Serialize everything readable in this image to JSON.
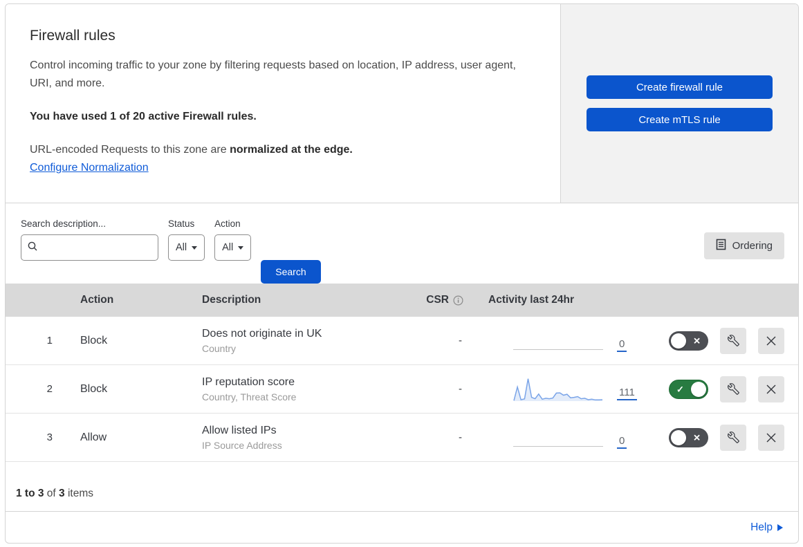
{
  "header": {
    "title": "Firewall rules",
    "description": "Control incoming traffic to your zone by filtering requests based on location, IP address, user agent, URI, and more.",
    "usage_bold": "You have used 1 of 20 active Firewall rules.",
    "normalization_prefix": "URL-encoded Requests to this zone are ",
    "normalization_bold": "normalized at the edge.",
    "normalization_link": "Configure Normalization",
    "create_firewall_button": "Create firewall rule",
    "create_mtls_button": "Create mTLS rule"
  },
  "filters": {
    "search_label": "Search description...",
    "search_value": "",
    "status_label": "Status",
    "status_value": "All",
    "action_label": "Action",
    "action_value": "All",
    "search_button": "Search",
    "ordering_button": "Ordering"
  },
  "table": {
    "headers": {
      "action": "Action",
      "description": "Description",
      "csr": "CSR",
      "activity": "Activity last 24hr"
    },
    "rows": [
      {
        "priority": "1",
        "action": "Block",
        "description": "Does not originate in UK",
        "filter_fields": "Country",
        "csr": "-",
        "activity_count": "0",
        "enabled": false,
        "sparkline": null
      },
      {
        "priority": "2",
        "action": "Block",
        "description": "IP reputation score",
        "filter_fields": "Country, Threat Score",
        "csr": "-",
        "activity_count": "111",
        "enabled": true,
        "sparkline": [
          2,
          60,
          6,
          9,
          95,
          16,
          10,
          30,
          8,
          12,
          10,
          13,
          34,
          35,
          25,
          29,
          14,
          16,
          19,
          10,
          12,
          6,
          8,
          5,
          5,
          6
        ]
      },
      {
        "priority": "3",
        "action": "Allow",
        "description": "Allow listed IPs",
        "filter_fields": "IP Source Address",
        "csr": "-",
        "activity_count": "0",
        "enabled": false,
        "sparkline": null
      }
    ]
  },
  "footer": {
    "range_text": "1 to 3",
    "of_text": " of ",
    "total_text": "3",
    "items_text": " items",
    "help_label": "Help"
  },
  "colors": {
    "primary_blue": "#0b55cd",
    "link_blue": "#0f5bd8",
    "toggle_on_green": "#287b41",
    "toggle_off_gray": "#4d4f54",
    "table_header_gray": "#d9d9d9",
    "side_panel_gray": "#f2f2f2",
    "sparkline_blue": "#7aa4e8"
  }
}
